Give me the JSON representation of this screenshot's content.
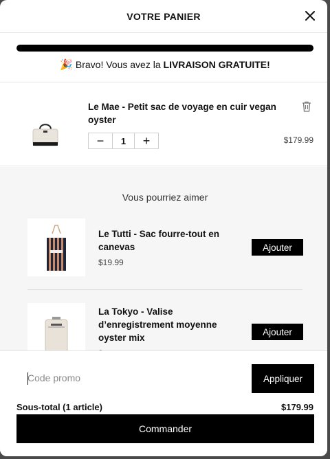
{
  "header": {
    "title": "VOTRE PANIER",
    "close_icon": "close-icon"
  },
  "shipping": {
    "progress_fraction": 1.0,
    "message_prefix": "Bravo! Vous avez la ",
    "message_strong": "LIVRAISON GRATUITE!",
    "emoji": "🎉"
  },
  "cart_item": {
    "name": "Le Mae - Petit sac de voyage en cuir vegan oyster",
    "quantity": "1",
    "minus": "−",
    "plus": "+",
    "price": "$179.99",
    "trash_icon": "trash-icon"
  },
  "recommendations": {
    "heading": "Vous pourriez aimer",
    "items": [
      {
        "name": "Le Tutti - Sac fourre-tout en canevas",
        "price": "$19.99",
        "add_label": "Ajouter"
      },
      {
        "name": "La Tokyo - Valise d’enregistrement moyenne oyster mix",
        "price": "$",
        "add_label": "Ajouter"
      }
    ]
  },
  "footer": {
    "promo_placeholder": "Code promo",
    "apply_label": "Appliquer",
    "subtotal_label": "Sous-total (1 article)",
    "subtotal_value": "$179.99",
    "checkout_label": "Commander"
  },
  "colors": {
    "accent": "#000000",
    "panel_bg": "#ffffff",
    "reco_bg": "#f6f6f6"
  }
}
